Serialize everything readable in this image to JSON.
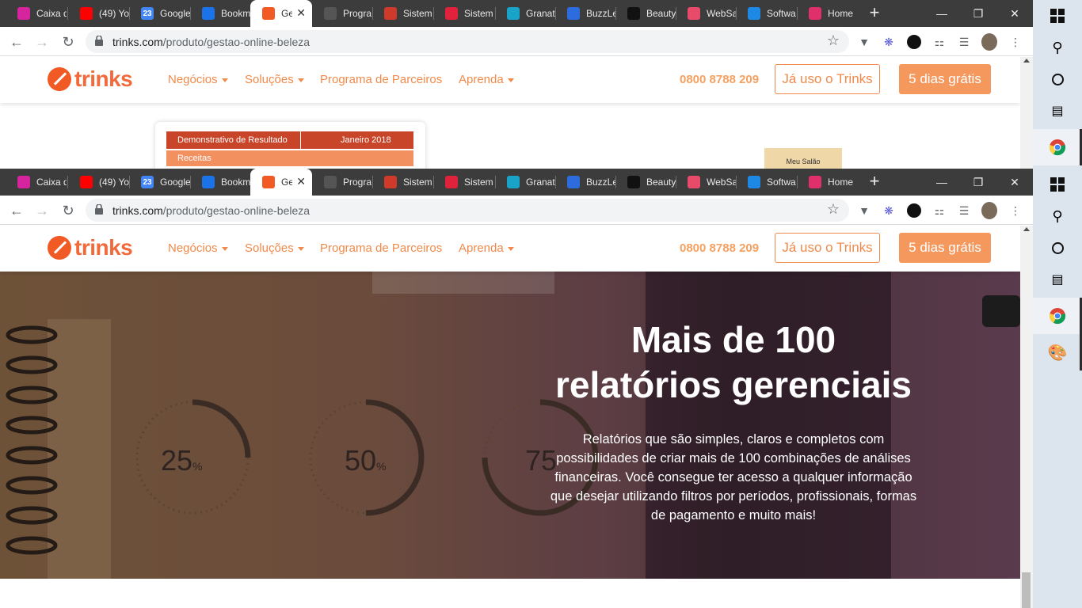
{
  "browser": {
    "tabs": [
      {
        "label": "Caixa d",
        "icon": "instagram-icon",
        "color": "#d6249f"
      },
      {
        "label": "(49) Yo",
        "icon": "youtube-icon",
        "color": "#ff0000"
      },
      {
        "label": "Google",
        "icon": "google-calendar-icon",
        "color": "#4285f4",
        "glyph": "23"
      },
      {
        "label": "Bookm",
        "icon": "bookmark-star-icon",
        "color": "#1a73e8"
      },
      {
        "label": "Ges",
        "icon": "trinks-icon",
        "color": "#f15a24",
        "active": true
      },
      {
        "label": "Progra",
        "icon": "globe-icon",
        "color": "#555"
      },
      {
        "label": "Sistem",
        "icon": "sistema-icon",
        "color": "#d03a2b"
      },
      {
        "label": "Sistem",
        "icon": "s-logo-icon",
        "color": "#e0223a"
      },
      {
        "label": "Granat",
        "icon": "granatum-icon",
        "color": "#1aa3c9"
      },
      {
        "label": "BuzzLe",
        "icon": "buzzlead-icon",
        "color": "#2d6cdf"
      },
      {
        "label": "Beauty",
        "icon": "beauty-icon",
        "color": "#111"
      },
      {
        "label": "WebSa",
        "icon": "websalon-icon",
        "color": "#e84a6a"
      },
      {
        "label": "Softwa",
        "icon": "software-icon",
        "color": "#1e88e5"
      },
      {
        "label": "Home",
        "icon": "home-p-icon",
        "color": "#e0306c"
      }
    ],
    "url_domain": "trinks.com",
    "url_path": "/produto/gestao-online-beleza"
  },
  "header": {
    "logo_text": "trinks",
    "nav": [
      {
        "label": "Negócios",
        "dropdown": true
      },
      {
        "label": "Soluções",
        "dropdown": true
      },
      {
        "label": "Programa de Parceiros",
        "dropdown": false
      },
      {
        "label": "Aprenda",
        "dropdown": true
      }
    ],
    "phone": "0800 8788 209",
    "login_button": "Já uso o Trinks",
    "trial_button": "5 dias grátis"
  },
  "report_card": {
    "col1": "Demonstrativo de Resultado",
    "col2": "Janeiro 2018",
    "row": "Receitas",
    "salon_label": "Meu Salão"
  },
  "hero": {
    "title_line1": "Mais de 100",
    "title_line2": "relatórios gerenciais",
    "text": "Relatórios que são simples, claros e completos com possibilidades de criar mais de 100 combinações de análises financeiras. Você consegue ter acesso a qualquer informação que desejar utilizando filtros por períodos, profissionais, formas de pagamento e muito mais!",
    "gauges": [
      {
        "value": "25",
        "unit": "%"
      },
      {
        "value": "50",
        "unit": "%"
      },
      {
        "value": "75",
        "unit": ""
      }
    ]
  },
  "colors": {
    "brand": "#f15a24",
    "accent": "#f08a4b",
    "cta": "#f5985e"
  }
}
